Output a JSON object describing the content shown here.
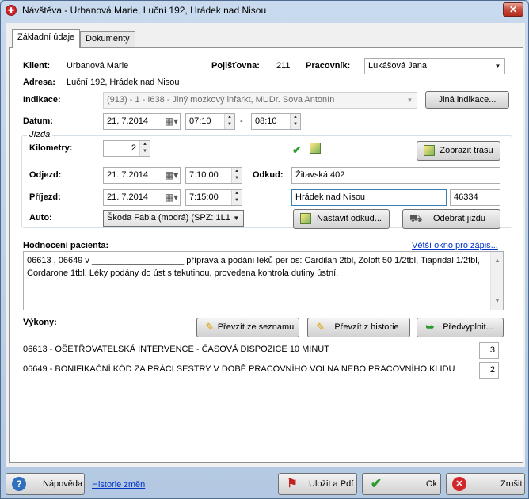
{
  "window": {
    "title": "Návštěva - Urbanová Marie, Luční 192, Hrádek nad Nisou",
    "close": "✕"
  },
  "tabs": [
    {
      "label": "Základní údaje"
    },
    {
      "label": "Dokumenty"
    }
  ],
  "client": {
    "label": "Klient:",
    "value": "Urbanová Marie"
  },
  "insurer": {
    "label": "Pojišťovna:",
    "value": "211"
  },
  "worker": {
    "label": "Pracovník:",
    "value": "Lukášová Jana"
  },
  "address": {
    "label": "Adresa:",
    "value": "Luční 192, Hrádek nad Nisou"
  },
  "indication": {
    "label": "Indikace:",
    "value": "(913) - 1 - I638 - Jiný mozkový infarkt, MUDr. Sova Antonín",
    "other_button": "Jiná indikace..."
  },
  "date": {
    "label": "Datum:",
    "value": "21.  7.2014",
    "time_from": "07:10",
    "dash": "-",
    "time_to": "08:10"
  },
  "trip": {
    "group_title": "Jízda",
    "km_label": "Kilometry:",
    "km_value": "2",
    "departure_label": "Odjezd:",
    "departure_date": "21.  7.2014",
    "departure_time": "7:10:00",
    "arrival_label": "Příjezd:",
    "arrival_date": "21.  7.2014",
    "arrival_time": "7:15:00",
    "car_label": "Auto:",
    "car_value": "Škoda Fabia (modrá) (SPZ: 1L1 ·",
    "from_label": "Odkud:",
    "from_street": "Žitavská 402",
    "to_city": "Hrádek nad Nisou",
    "to_zip": "46334",
    "show_route": "Zobrazit trasu",
    "set_from": "Nastavit odkud...",
    "remove_trip": "Odebrat jízdu"
  },
  "evaluation": {
    "label": "Hodnocení pacienta:",
    "bigger_window": "Větší okno pro zápis...",
    "text": "06613 , 06649  v  ___________________ příprava a podání léků per os: Cardilan 2tbl, Zoloft 50 1/2tbl, Tiapridal 1/2tbl, Cordarone 1tbl. Léky podány do úst s tekutinou, provedena kontrola dutiny ústní."
  },
  "procedures": {
    "label": "Výkony:",
    "from_list": "Převzít ze seznamu",
    "from_history": "Převzít z historie",
    "prefilled": "Předvyplnit...",
    "items": [
      {
        "text": "06613 - OŠETŘOVATELSKÁ INTERVENCE - ČASOVÁ DISPOZICE 10 MINUT",
        "qty": "3"
      },
      {
        "text": "06649 - BONIFIKAČNÍ KÓD ZA PRÁCI SESTRY V DOBĚ PRACOVNÍHO VOLNA NEBO PRACOVNÍHO KLIDU",
        "qty": "2"
      }
    ]
  },
  "footer": {
    "help": "Nápověda",
    "history": "Historie změn",
    "save_pdf": "Uložit a Pdf",
    "ok": "Ok",
    "cancel": "Zrušit"
  },
  "icons": {
    "app": "visit-app-icon",
    "calendar": "calendar-icon",
    "check": "check-icon",
    "map": "map-icon",
    "pencil": "pencil-icon",
    "arrow": "arrow-icon",
    "car": "car-icon",
    "help": "help-icon",
    "pdf": "pdf-icon",
    "ok": "ok-icon",
    "cancel": "cancel-icon"
  },
  "colors": {
    "accent": "#0033cc",
    "title_bar": "#c9daee",
    "close_button": "#c74a3a"
  }
}
